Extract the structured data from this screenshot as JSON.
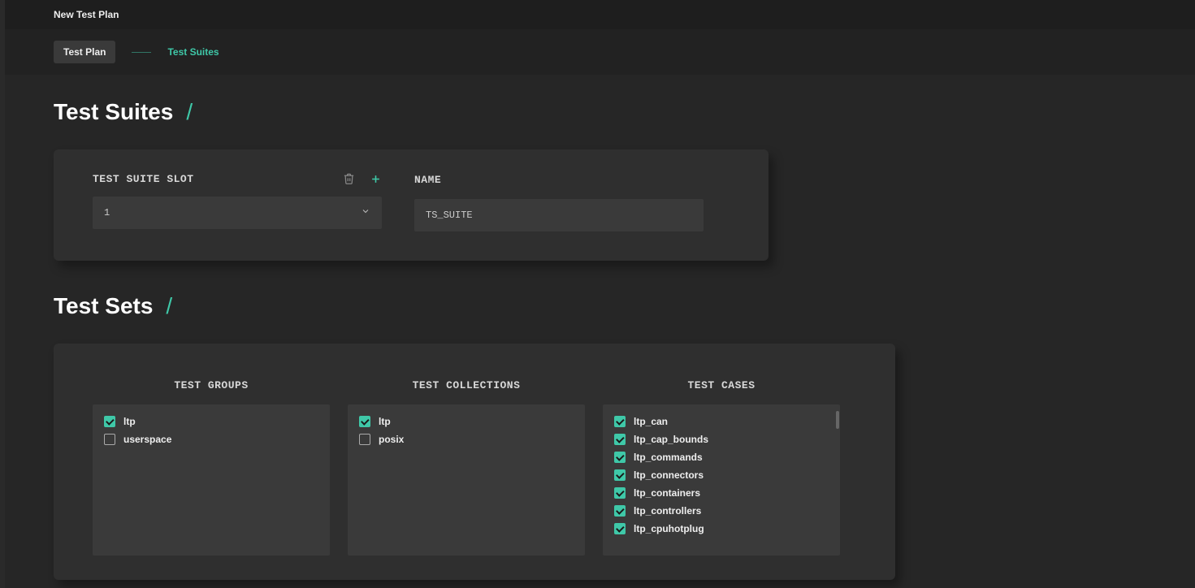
{
  "header": {
    "title": "New Test Plan"
  },
  "tabs": {
    "plan_label": "Test Plan",
    "suites_label": "Test Suites"
  },
  "sections": {
    "suites_title": "Test Suites",
    "sets_title": "Test Sets"
  },
  "suite_form": {
    "slot_label": "TEST SUITE SLOT",
    "slot_value": "1",
    "name_label": "NAME",
    "name_value": "TS_SUITE"
  },
  "columns": {
    "groups_label": "TEST GROUPS",
    "collections_label": "TEST COLLECTIONS",
    "cases_label": "TEST CASES"
  },
  "test_groups": [
    {
      "label": "ltp",
      "checked": true
    },
    {
      "label": "userspace",
      "checked": false
    }
  ],
  "test_collections": [
    {
      "label": "ltp",
      "checked": true
    },
    {
      "label": "posix",
      "checked": false
    }
  ],
  "test_cases": [
    {
      "label": "ltp_can",
      "checked": true
    },
    {
      "label": "ltp_cap_bounds",
      "checked": true
    },
    {
      "label": "ltp_commands",
      "checked": true
    },
    {
      "label": "ltp_connectors",
      "checked": true
    },
    {
      "label": "ltp_containers",
      "checked": true
    },
    {
      "label": "ltp_controllers",
      "checked": true
    },
    {
      "label": "ltp_cpuhotplug",
      "checked": true
    }
  ],
  "colors": {
    "accent": "#3fc8a8"
  }
}
